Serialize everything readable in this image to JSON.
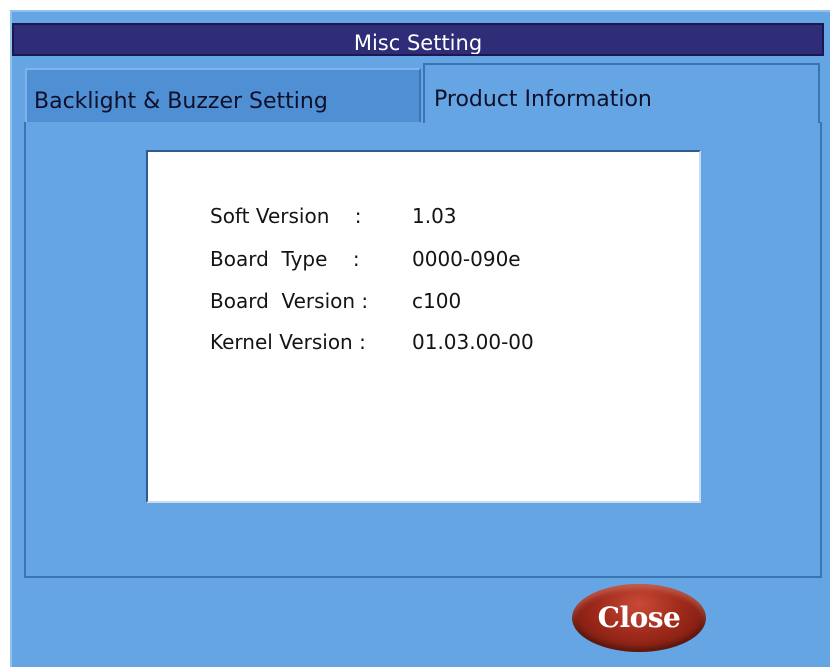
{
  "window": {
    "title": "Misc Setting"
  },
  "tabs": [
    {
      "label": "Backlight & Buzzer Setting"
    },
    {
      "label": "Product Information"
    }
  ],
  "product_info": {
    "rows": [
      {
        "label": "Soft Version    :",
        "value": "1.03"
      },
      {
        "label": "Board  Type    :",
        "value": "0000-090e"
      },
      {
        "label": "Board  Version :",
        "value": "c100"
      },
      {
        "label": "Kernel Version :",
        "value": "01.03.00-00"
      }
    ]
  },
  "buttons": {
    "close_label": "Close"
  }
}
